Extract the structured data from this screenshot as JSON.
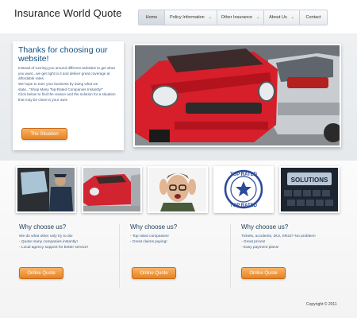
{
  "header": {
    "logo_text": "Insurance World Quote",
    "nav": [
      {
        "label": "Home",
        "has_dropdown": false
      },
      {
        "label": "Policy Information",
        "has_dropdown": true
      },
      {
        "label": "Other Insurance",
        "has_dropdown": true
      },
      {
        "label": "About Us",
        "has_dropdown": true
      },
      {
        "label": "Contact",
        "has_dropdown": false
      }
    ]
  },
  "welcome": {
    "title": "Thanks for choosing our website!",
    "body": [
      "Instead of running you around different websites to get what you want...we get right to it and deliver great coverage at affordable rates.",
      "We hope to earn your business by doing what we state...\"Shop Many Top-Rated Companies Instantly!\"",
      "Click below to find the reason and the solution for a situation that may be close to your own!"
    ],
    "button": "The Situation"
  },
  "thumbnails": [
    {
      "name": "police-officer-photo"
    },
    {
      "name": "crashed-car-photo"
    },
    {
      "name": "stressed-man-photo"
    },
    {
      "name": "top-rated-stamp",
      "text": "TOP RATED"
    },
    {
      "name": "solutions-keyboard-photo",
      "text": "SOLUTIONS"
    }
  ],
  "columns": [
    {
      "title": "Why choose us?",
      "lines": [
        "We do what other only try to do!",
        "- Quote many companies instantly!",
        "- Local agency support for better service!"
      ],
      "button": "Online Quote"
    },
    {
      "title": "Why choose us?",
      "lines": [
        "- Top rated companies!",
        "- Great claims paying!"
      ],
      "button": "Online Quote"
    },
    {
      "title": "Why choose us?",
      "lines": [
        "Tickets, accidents, DUI, SR22? No problem!",
        "- Great prices!",
        "- Easy payment plans!"
      ],
      "button": "Online Quote"
    }
  ],
  "footer": {
    "copyright": "Copyright © 2011"
  },
  "colors": {
    "accent": "#e8821f",
    "heading": "#0f4f7f",
    "body_text": "#3d5a80"
  }
}
